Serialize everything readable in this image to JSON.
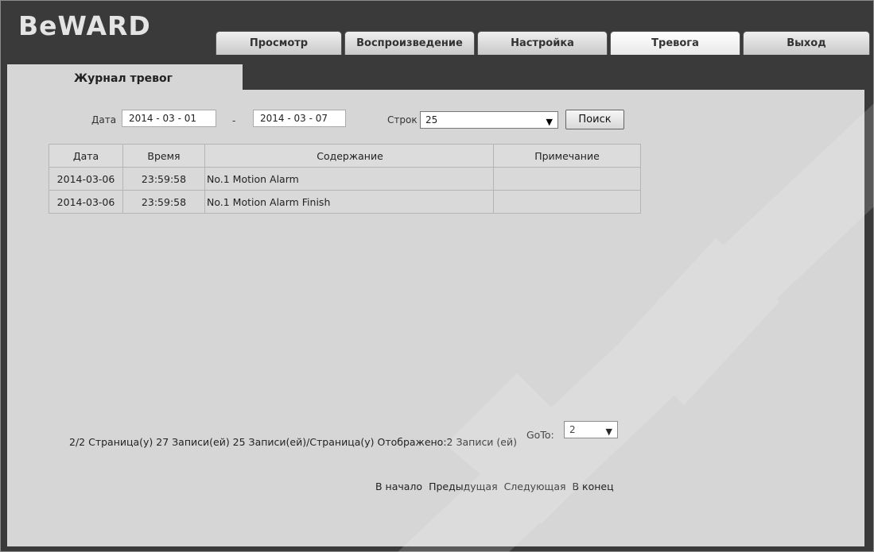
{
  "app": {
    "logo": "BeWARD"
  },
  "tabs": [
    {
      "label": "Просмотр",
      "active": false
    },
    {
      "label": "Воспроизведение",
      "active": false
    },
    {
      "label": "Настройка",
      "active": false
    },
    {
      "label": "Тревога",
      "active": true
    },
    {
      "label": "Выход",
      "active": false
    }
  ],
  "section": {
    "title": "Журнал тревог"
  },
  "filter": {
    "date_label": "Дата",
    "date_from": "2014 - 03 - 01",
    "separator": "-",
    "date_to": "2014 - 03 - 07",
    "rows_label": "Строк",
    "rows_value": "25",
    "search_label": "Поиск"
  },
  "table": {
    "headers": [
      "Дата",
      "Время",
      "Содержание",
      "Примечание"
    ],
    "rows": [
      [
        "2014-03-06",
        "23:59:58",
        "No.1 Motion Alarm",
        ""
      ],
      [
        "2014-03-06",
        "23:59:58",
        "No.1 Motion Alarm Finish",
        ""
      ]
    ]
  },
  "pager": {
    "summary": "2/2 Страница(у) 27 Записи(ей) 25 Записи(ей)/Страница(у) Отображено:2 Записи (ей)",
    "goto_label": "GoTo:",
    "goto_value": "2",
    "first": "В начало",
    "prev": "Предыдущая",
    "next": "Следующая",
    "last": "В конец"
  }
}
